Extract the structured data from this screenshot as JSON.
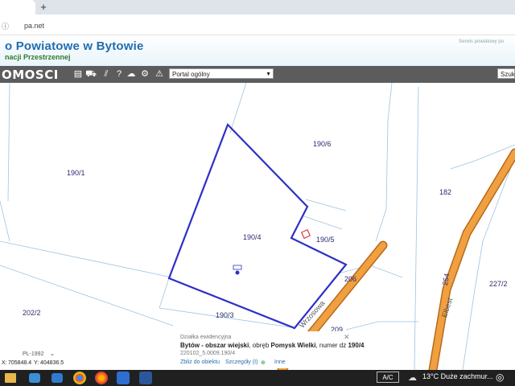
{
  "browser": {
    "tab_title": "",
    "new_tab_label": "+",
    "address": "pa.net"
  },
  "header": {
    "title": "o Powiatowe w Bytowie",
    "subtitle": "nacji Przestrzennej",
    "right_text": "Serwis powiatowy po"
  },
  "toolbar": {
    "tools_label": "OMOSCI",
    "portal_select": "Portal ogólny",
    "search_label": "Szuk"
  },
  "map": {
    "parcels": [
      "190/6",
      "190/1",
      "182",
      "190/4",
      "190/5",
      "206",
      "227/2",
      "202/2",
      "190/3",
      "209",
      "254"
    ],
    "streets": [
      "Wrzosowa",
      "Elbest"
    ]
  },
  "popup": {
    "title": "Działka ewidencyjna",
    "close": "✕",
    "line_prefix": "Bytów - obszar wiejski",
    "line_mid": ", obręb ",
    "obreb": "Pomysk Wielki",
    "line_num": ", numer dz ",
    "number": "190/4",
    "id": "220102_5.0009.190/4",
    "link_zoom": "Zbliż do obiektu",
    "link_details": "Szczegóły (I)",
    "link_other": "Inne"
  },
  "coords": {
    "scale": "PL-1992",
    "x_label": "X:",
    "x": "705848.4",
    "y_label": "Y:",
    "y": "404836.5"
  },
  "taskbar": {
    "ac": "A/C",
    "weather": "13°C  Duże zachmur..."
  },
  "colors": {
    "parcel_outline": "#2f2fc8",
    "road_fill": "#f0a040",
    "road_edge": "#b86a1c",
    "toolbar": "#5c5c5c"
  }
}
